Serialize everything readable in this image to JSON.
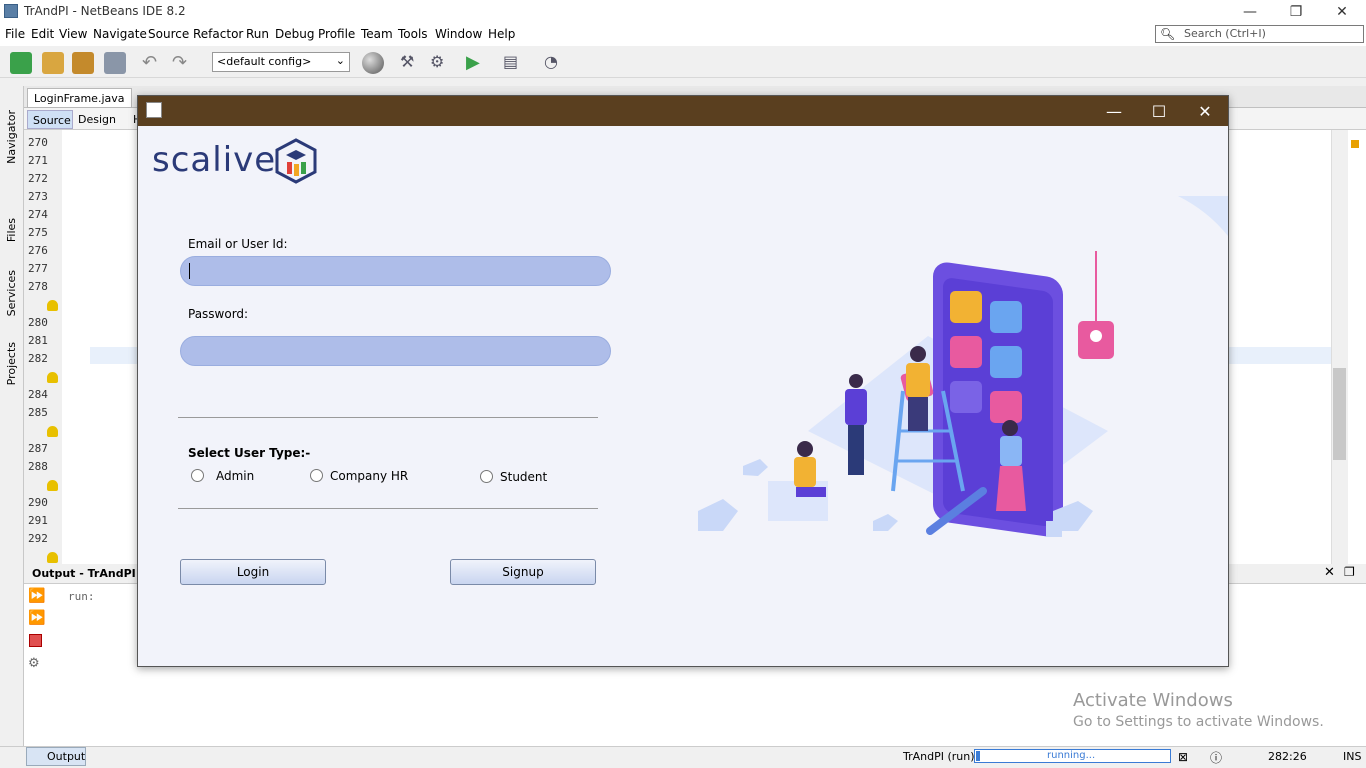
{
  "app": {
    "title": "TrAndPI - NetBeans IDE 8.2",
    "window_controls": {
      "minimize": "—",
      "restore": "❐",
      "close": "✕"
    },
    "menu": [
      "File",
      "Edit",
      "View",
      "Navigate",
      "Source",
      "Refactor",
      "Run",
      "Debug",
      "Profile",
      "Team",
      "Tools",
      "Window",
      "Help"
    ],
    "search_placeholder": "Search (Ctrl+I)",
    "config_value": "<default config>"
  },
  "editor": {
    "active_tab": "LoginFrame.java",
    "subtabs": [
      "Source",
      "Design",
      "H"
    ],
    "line_numbers": [
      "270",
      "271",
      "272",
      "273",
      "274",
      "275",
      "276",
      "277",
      "278",
      "",
      "280",
      "281",
      "282",
      "",
      "284",
      "285",
      "",
      "287",
      "288",
      "",
      "290",
      "291",
      "292",
      ""
    ],
    "side_labels": [
      "Navigator",
      "Files",
      "Services",
      "Projects"
    ]
  },
  "output": {
    "title": "Output - TrAndPI (r",
    "text": "run:"
  },
  "statusbar": {
    "output_tab": "Output",
    "project": "TrAndPI (run)",
    "progress_text": "running...",
    "position": "282:26",
    "mode": "INS"
  },
  "activation": {
    "line1": "Activate Windows",
    "line2": "Go to Settings to activate Windows."
  },
  "login": {
    "logo_text": "scalive",
    "email_label": "Email or User Id:",
    "password_label": "Password:",
    "user_type_label": "Select User Type:-",
    "options": [
      "Admin",
      "Company HR",
      "Student"
    ],
    "login_button": "Login",
    "signup_button": "Signup"
  },
  "colors": {
    "dialog_titlebar": "#5a3f1f",
    "field_fill": "#aebde9",
    "logo_navy": "#2b3a78",
    "illustration_purple": "#5b3fd6"
  }
}
